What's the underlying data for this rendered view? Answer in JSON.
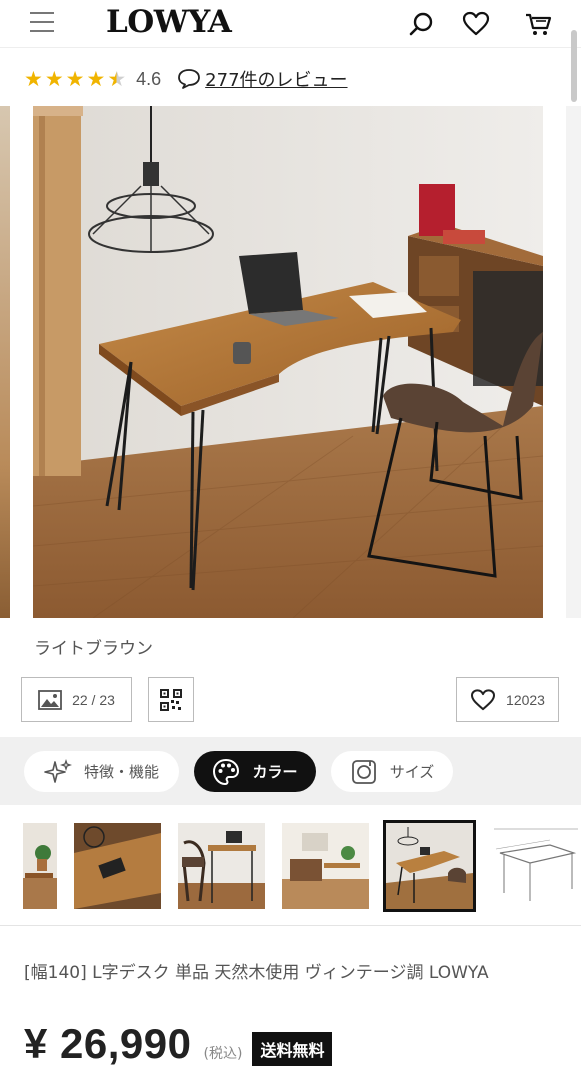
{
  "header": {
    "logo": "LOWYA",
    "icons": [
      "menu-icon",
      "search-icon",
      "heart-icon",
      "cart-icon"
    ]
  },
  "rating": {
    "value": "4.6",
    "stars": 4.5,
    "reviews_label": "277件のレビュー"
  },
  "gallery": {
    "color_name": "ライトブラウン",
    "counter": "22 / 23",
    "favorite_count": "12023"
  },
  "tabs": [
    {
      "label": "特徴・機能",
      "icon": "sparkle-icon",
      "active": false
    },
    {
      "label": "カラー",
      "icon": "palette-icon",
      "active": true
    },
    {
      "label": "サイズ",
      "icon": "ruler-icon",
      "active": false
    }
  ],
  "product": {
    "title": "[幅140] L字デスク 単品 天然木使用 ヴィンテージ調  LOWYA",
    "price": "¥ 26,990",
    "tax_label": "(税込)",
    "shipping_badge": "送料無料"
  },
  "colors": {
    "star": "#f0b400",
    "active_tab": "#111111",
    "wood": "#b07a3f"
  }
}
